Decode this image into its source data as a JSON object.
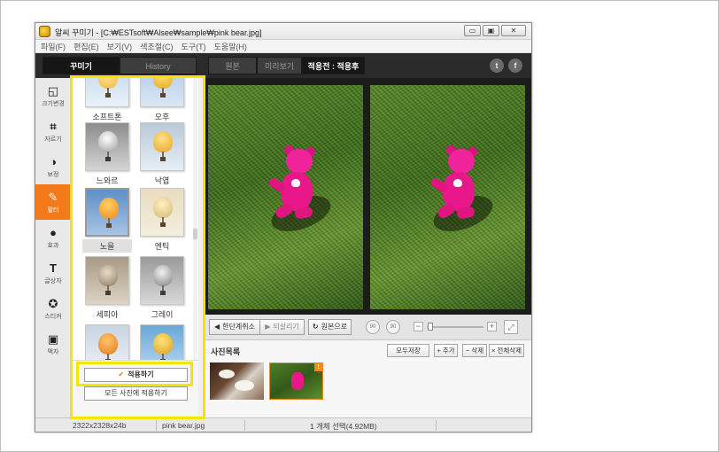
{
  "window": {
    "title": "알씨 꾸미기 - [C:₩ESTsoft₩Alsee₩sample₩pink bear.jpg]",
    "minimize": "▭",
    "maximize": "▣",
    "close": "✕"
  },
  "menu": {
    "items": [
      {
        "label": "파일(F)"
      },
      {
        "label": "편집(E)"
      },
      {
        "label": "보기(V)"
      },
      {
        "label": "색조절(C)"
      },
      {
        "label": "도구(T)"
      },
      {
        "label": "도움말(H)"
      }
    ]
  },
  "toolbar": {
    "left_tabs": [
      {
        "label": "꾸미기",
        "active": true
      },
      {
        "label": "History",
        "active": false
      }
    ],
    "view_tabs": [
      {
        "label": "원본",
        "active": false
      },
      {
        "label": "미리보기",
        "active": false
      },
      {
        "label": "적용전 : 적용후",
        "active": true
      }
    ],
    "social": {
      "twitter": "t",
      "facebook": "f"
    }
  },
  "sidebar": {
    "items": [
      {
        "label": "크기변경",
        "icon": "resize-icon",
        "glyph": "◱"
      },
      {
        "label": "자르기",
        "icon": "crop-icon",
        "glyph": "⌗"
      },
      {
        "label": "보정",
        "icon": "adjust-icon",
        "glyph": "◑"
      },
      {
        "label": "필터",
        "icon": "filter-wand-icon",
        "glyph": "✎"
      },
      {
        "label": "효과",
        "icon": "drop-icon",
        "glyph": "●"
      },
      {
        "label": "글상자",
        "icon": "text-icon",
        "glyph": "T"
      },
      {
        "label": "스티커",
        "icon": "sticker-icon",
        "glyph": "✪"
      },
      {
        "label": "액자",
        "icon": "frame-icon",
        "glyph": "▣"
      }
    ],
    "active_index": 3
  },
  "filters": {
    "items": [
      {
        "label": "소프트톤"
      },
      {
        "label": "오후"
      },
      {
        "label": "느와르"
      },
      {
        "label": "낙엽"
      },
      {
        "label": "노을",
        "selected": true
      },
      {
        "label": "엔틱"
      },
      {
        "label": "세피아"
      },
      {
        "label": "그레이"
      },
      {
        "label": ""
      },
      {
        "label": ""
      }
    ],
    "apply_label": "적용하기",
    "apply_all_label": "모든 사진에 적용하기"
  },
  "edit_bar": {
    "undo": "한단계취소",
    "redo": "되살리기",
    "original": "원본으로",
    "rotate_left": "90",
    "rotate_right": "90",
    "zoom_out": "−",
    "zoom_in": "+",
    "fit": "⤢"
  },
  "photo_list": {
    "title": "사진목록",
    "save_all": "모두저장",
    "add": "+ 추가",
    "delete": "− 삭제",
    "delete_all": "× 전체삭제",
    "modified_badge": "!"
  },
  "status": {
    "dimensions": "2322x2328x24b",
    "filename": "pink bear.jpg",
    "selection": "1 개체 선택(4.92MB)"
  },
  "colors": {
    "accent_orange": "#f27a1a",
    "highlight_yellow": "#f5e600",
    "toolbar_dark": "#2a2a2a"
  }
}
